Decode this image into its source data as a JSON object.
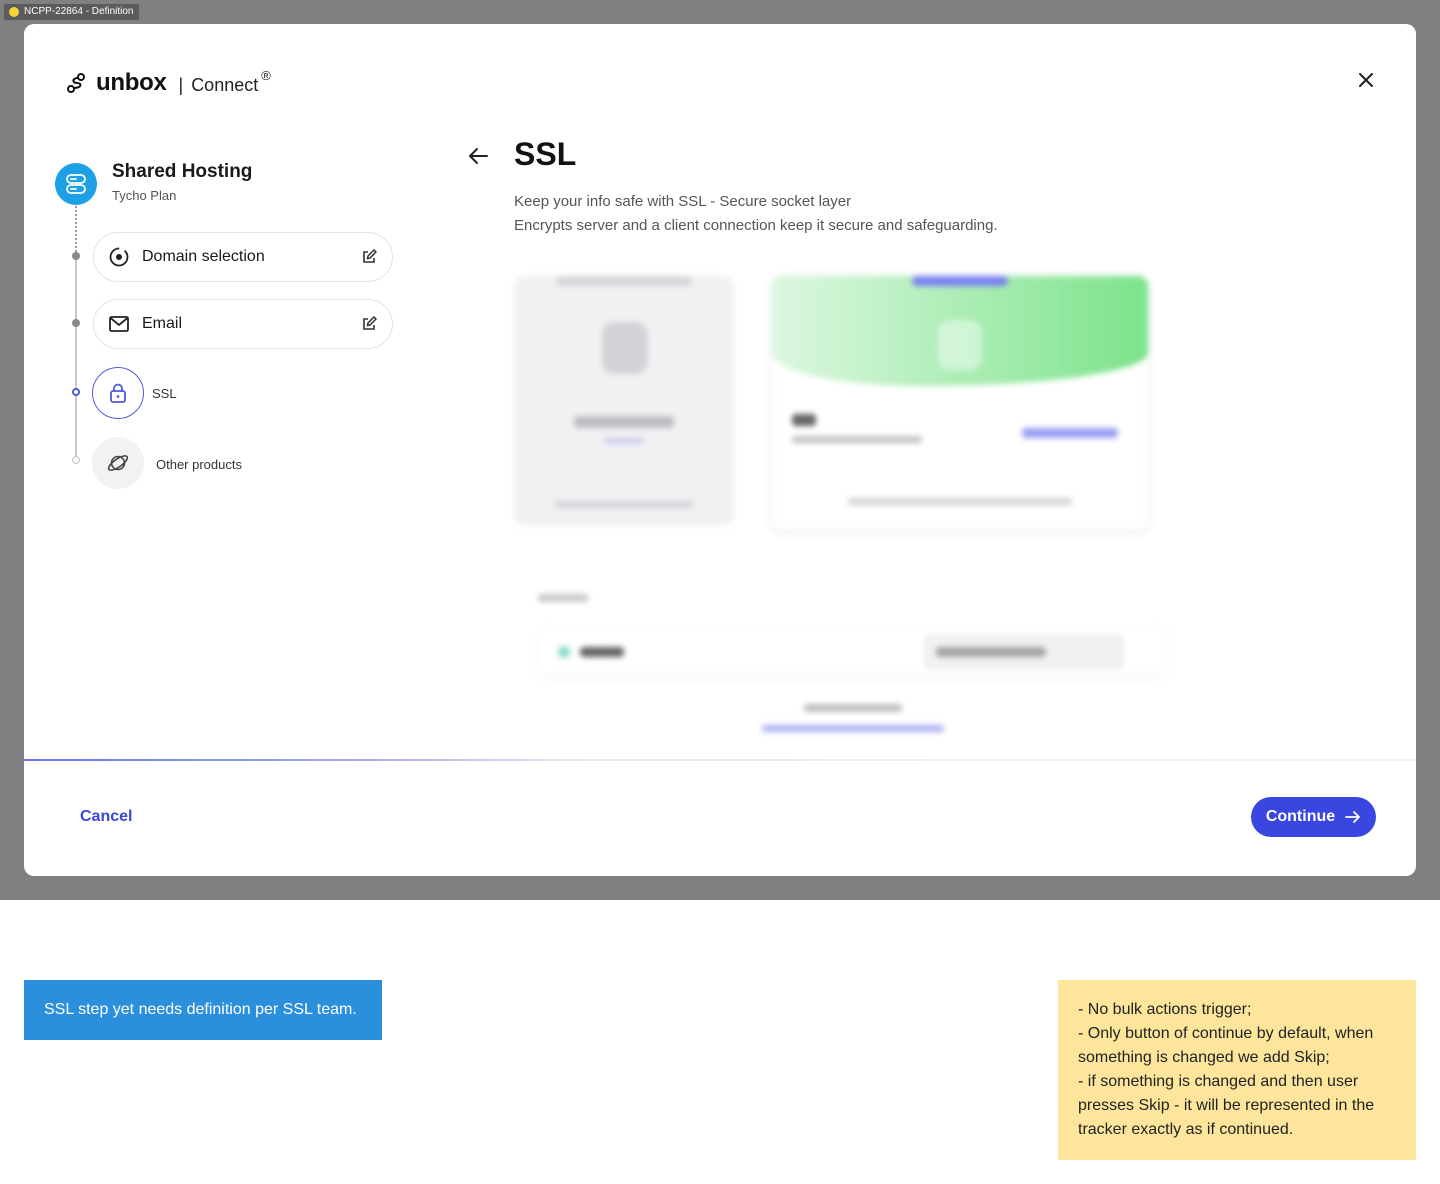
{
  "frame": {
    "tag": "NCPP-22864 - Definition"
  },
  "brand": {
    "name": "unbox",
    "separator": "|",
    "product": "Connect",
    "reg": "®"
  },
  "stepper": {
    "plan_title": "Shared Hosting",
    "plan_subtitle": "Tycho Plan",
    "steps": [
      {
        "label": "Domain selection",
        "state": "done"
      },
      {
        "label": "Email",
        "state": "done"
      },
      {
        "label": "SSL",
        "state": "active"
      },
      {
        "label": "Other products",
        "state": "future"
      }
    ]
  },
  "main": {
    "title": "SSL",
    "description_line1": "Keep your info safe with SSL - Secure socket layer",
    "description_line2": "Encrypts server and a client connection keep it secure and safeguarding."
  },
  "footer": {
    "cancel_label": "Cancel",
    "continue_label": "Continue"
  },
  "annotations": {
    "blue_note": "SSL step yet needs definition per SSL team.",
    "yellow_note": [
      "- No bulk actions trigger;",
      "- Only button of continue by default, when something is changed we add Skip;",
      "- if something is changed and then user presses Skip - it will be represented in the tracker exactly as if continued."
    ]
  },
  "colors": {
    "accent": "#3a46e0",
    "plan_icon": "#1ea0e6",
    "blue_note": "#2b8fdc",
    "yellow_note": "#fde69c"
  },
  "icons": [
    "unbox-logo-icon",
    "close-icon",
    "server-icon",
    "target-icon",
    "edit-icon",
    "mail-icon",
    "lock-icon",
    "planet-icon",
    "arrow-left-icon",
    "arrow-right-icon"
  ]
}
